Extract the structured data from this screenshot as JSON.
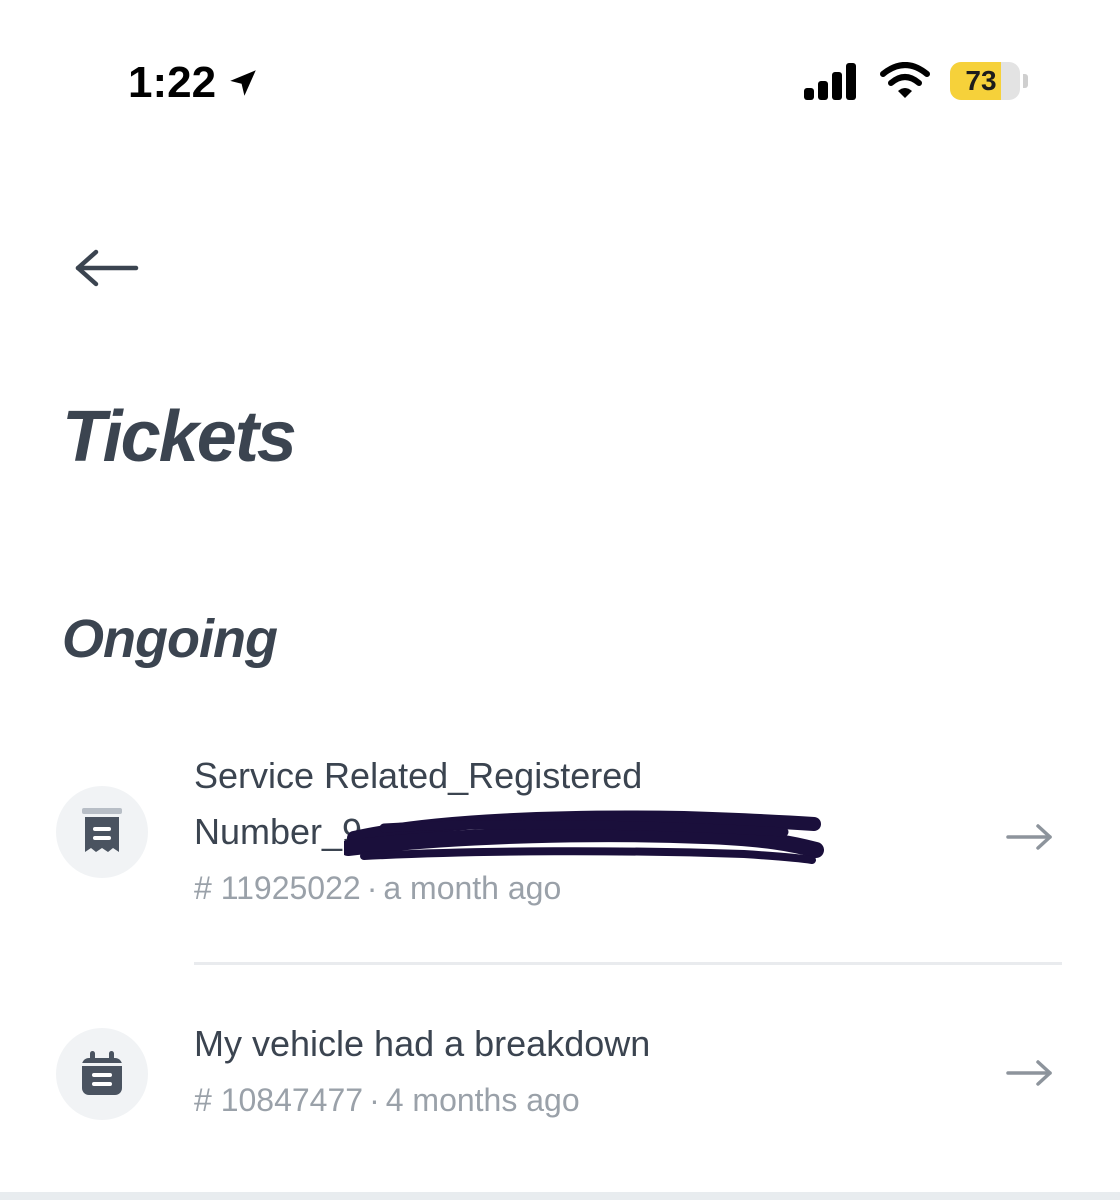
{
  "status_bar": {
    "time": "1:22",
    "battery_level": "73",
    "battery_fraction": 0.73,
    "icons": [
      "location-arrow-icon",
      "cellular-signal-icon",
      "wifi-icon",
      "battery-icon"
    ]
  },
  "nav": {
    "back_icon": "arrow-left-icon"
  },
  "page": {
    "title": "Tickets"
  },
  "sections": [
    {
      "title": "Ongoing",
      "tickets": [
        {
          "icon": "receipt-icon",
          "title_line1": "Service Related_Registered",
          "title_line2": "Number_9",
          "redacted": true,
          "number": "# 11925022",
          "age": "a month ago",
          "arrow_icon": "arrow-right-icon"
        },
        {
          "icon": "calendar-icon",
          "title_line1": "My vehicle had a breakdown",
          "number": "# 10847477",
          "age": "4 months ago",
          "arrow_icon": "arrow-right-icon"
        }
      ]
    }
  ],
  "meta_separator": "·",
  "colors": {
    "text_primary": "#3b4450",
    "text_secondary": "#9aa1a9",
    "icon_bg": "#f1f3f5",
    "battery_fill": "#f6d13a",
    "redaction": "#1a0f3b",
    "divider": "#e9ebee"
  }
}
